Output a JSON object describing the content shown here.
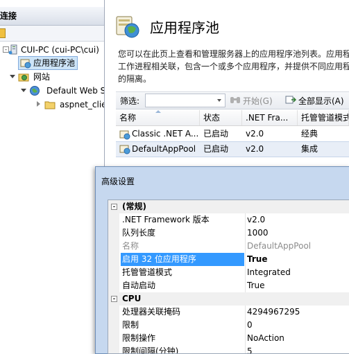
{
  "connections": {
    "header": "连接",
    "tree": {
      "server": "CUI-PC (cui-PC\\cui)",
      "app_pools": "应用程序池",
      "sites": "网站",
      "default_site": "Default Web S",
      "aspnet_folder": "aspnet_clie"
    }
  },
  "main": {
    "title": "应用程序池",
    "description": [
      "您可以在此页上查看和管理服务器上的应用程序池列表。应用程",
      "工作进程相关联，包含一个或多个应用程序，并提供不同应用程",
      "的隔离。"
    ],
    "filter": {
      "label": "筛选:",
      "start_label": "开始(G)",
      "show_all_label": "全部显示(A)"
    },
    "table": {
      "columns": [
        "名称",
        "状态",
        ".NET Fra...",
        "托管管道模式"
      ],
      "rows": [
        {
          "name": "Classic .NET A...",
          "status": "已启动",
          "net": "v2.0",
          "mode": "经典"
        },
        {
          "name": "DefaultAppPool",
          "status": "已启动",
          "net": "v2.0",
          "mode": "集成"
        }
      ]
    }
  },
  "dialog": {
    "title": "高级设置",
    "categories": [
      {
        "name": "(常规)",
        "properties": [
          {
            "name": ".NET Framework 版本",
            "value": "v2.0"
          },
          {
            "name": "队列长度",
            "value": "1000"
          },
          {
            "name": "名称",
            "value": "DefaultAppPool"
          },
          {
            "name": "启用 32 位应用程序",
            "value": "True"
          },
          {
            "name": "托管管道模式",
            "value": "Integrated"
          },
          {
            "name": "自动启动",
            "value": "True"
          }
        ]
      },
      {
        "name": "CPU",
        "properties": [
          {
            "name": "处理器关联掩码",
            "value": "4294967295"
          },
          {
            "name": "限制",
            "value": "0"
          },
          {
            "name": "限制操作",
            "value": "NoAction"
          },
          {
            "name": "限制间隔(分钟)",
            "value": "5"
          }
        ]
      }
    ]
  },
  "colors": {
    "selection": "#3399ff",
    "tree_selection": "#cde4f7",
    "dialog_frame": "#c6d8ef"
  }
}
